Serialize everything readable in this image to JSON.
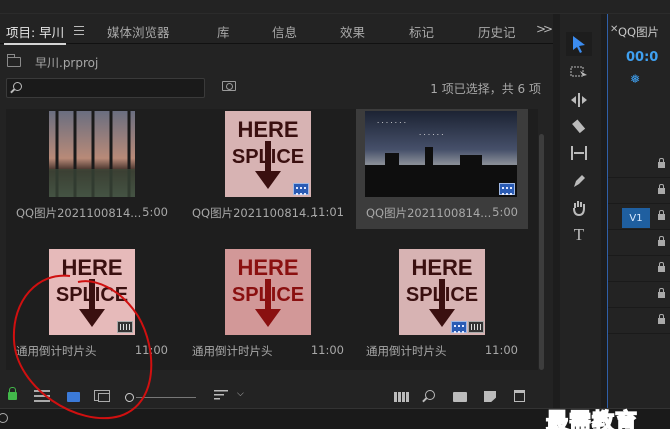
{
  "tabs": [
    {
      "label": "项目: 早川",
      "active": true
    },
    {
      "label": "媒体浏览器"
    },
    {
      "label": "库"
    },
    {
      "label": "信息"
    },
    {
      "label": "效果"
    },
    {
      "label": "标记"
    },
    {
      "label": "历史记"
    }
  ],
  "project": {
    "name": "早川.prproj",
    "search_placeholder": "",
    "selection_status": "1 项已选择，共 6 项"
  },
  "items": [
    {
      "name": "QQ图片2021100814...",
      "duration": "5:00",
      "kind": "photo",
      "selected": false
    },
    {
      "name": "QQ图片2021100814...",
      "duration": "11:01",
      "kind": "here-splice",
      "selected": false
    },
    {
      "name": "QQ图片2021100814...",
      "duration": "5:00",
      "kind": "photo",
      "selected": true
    },
    {
      "name": "通用倒计时片头",
      "duration": "11:00",
      "kind": "here-splice",
      "selected": false
    },
    {
      "name": "通用倒计时片头",
      "duration": "11:00",
      "kind": "here-splice",
      "selected": false
    },
    {
      "name": "通用倒计时片头",
      "duration": "11:00",
      "kind": "here-splice",
      "selected": false
    }
  ],
  "thumb_text": {
    "line1": "HERE",
    "line2": "SPLICE"
  },
  "timeline": {
    "tab": "QQ图片",
    "timecode": "00:0",
    "track_label": "V1"
  },
  "watermark": "最需教育",
  "colors": {
    "accent": "#3b7ad8",
    "timecode": "#3fa0f0",
    "annotation": "#d01010",
    "selected_bg": "#3c3c3c"
  }
}
